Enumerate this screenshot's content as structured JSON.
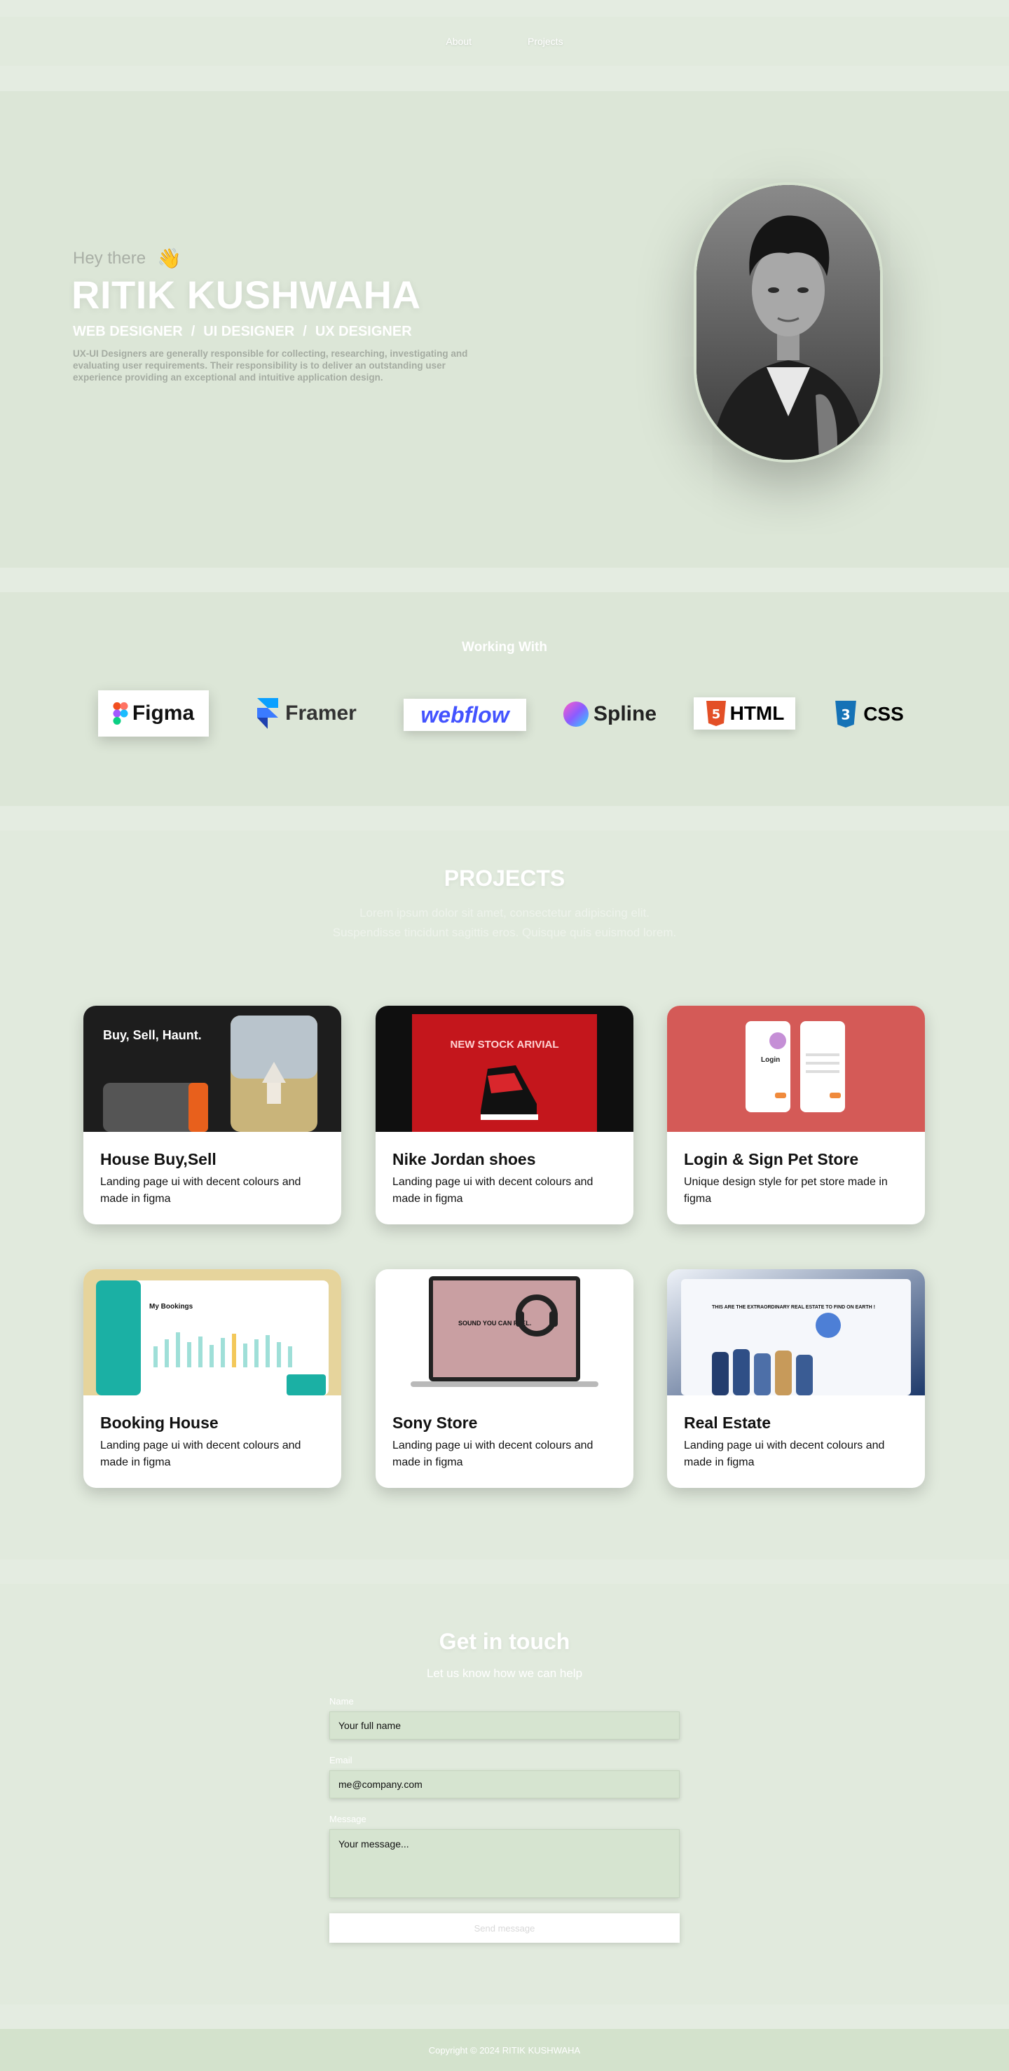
{
  "nav": {
    "items": [
      "About",
      "Projects"
    ]
  },
  "hero": {
    "greeting": "Hey there",
    "wave": "👋",
    "name": "RITIK KUSHWAHA",
    "roles": [
      "WEB DESIGNER",
      "/",
      "UI DESIGNER",
      "/",
      "UX DESIGNER"
    ],
    "description": "UX-UI Designers are generally responsible for collecting, researching, investigating and evaluating user requirements. Their responsibility is to deliver an outstanding user experience providing an exceptional and intuitive application design."
  },
  "working": {
    "title": "Working With",
    "tools": [
      "Figma",
      "Framer",
      "webflow",
      "Spline",
      "HTML",
      "CSS"
    ]
  },
  "projects": {
    "title": "PROJECTS",
    "subtitle": "Lorem ipsum dolor sit amet, consectetur adipiscing elit. Suspendisse tincidunt sagittis eros. Quisque quis euismod lorem.",
    "cards": [
      {
        "title": "House Buy,Sell",
        "desc": "Landing page ui with decent colours and made in  figma",
        "thumb_text": "Buy, Sell, Haunt.",
        "color": "#1d1d1d"
      },
      {
        "title": "Nike Jordan shoes",
        "desc": "Landing page ui with decent colours and made in figma",
        "thumb_text": "NEW STOCK ARIVIAL",
        "color": "#c4161c"
      },
      {
        "title": "Login & Sign Pet Store",
        "desc": "Unique design style for pet store made in figma",
        "thumb_text": "Login",
        "color": "#d45a57"
      },
      {
        "title": "Booking House",
        "desc": "Landing page ui with decent colours and made in  figma",
        "thumb_text": "My Bookings",
        "color": "#e6d49c"
      },
      {
        "title": "Sony Store",
        "desc": "Landing page ui with decent colours and made in  figma",
        "thumb_text": "SOUND YOU CAN FEEL.",
        "color": "#ffffff"
      },
      {
        "title": "Real Estate",
        "desc": "Landing page ui with decent colours and made in  figma",
        "thumb_text": "THIS ARE THE EXTRAORDINARY REAL ESTATE TO FIND ON EARTH !",
        "color": "#b8c9e6"
      }
    ]
  },
  "contact": {
    "title": "Get in touch",
    "subtitle": "Let us know how we can help",
    "name_label": "Name",
    "name_placeholder": "Your full name",
    "email_label": "Email",
    "email_placeholder": "me@company.com",
    "message_label": "Message",
    "message_placeholder": "Your message...",
    "send_label": "Send message"
  },
  "footer": {
    "text": "Copyright © 2024 RITIK KUSHWAHA"
  },
  "colors": {
    "page_bg": "#e4ece1",
    "section_bg": "#dce6d7",
    "field_bg": "#d6e4d0",
    "webflow": "#4353ff",
    "html": "#e34f26",
    "css": "#1572b6"
  }
}
